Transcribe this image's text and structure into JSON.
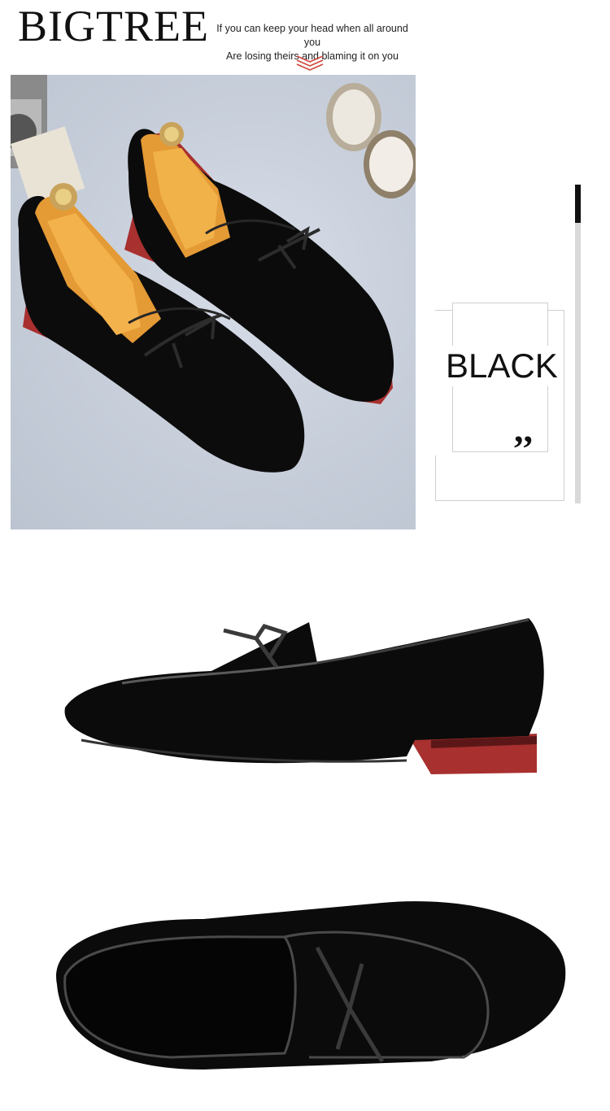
{
  "header": {
    "brand": "BIGTREE",
    "tagline_line1": "If you can keep your head when all around you",
    "tagline_line2": "Are losing theirs and blaming it on you"
  },
  "color_tag": {
    "label": "BLACK",
    "quote_mark": ",,"
  },
  "colors": {
    "shoe": "#0a0a0a",
    "heel_red": "#a8302f",
    "shoe_tree_wood": "#e8a13a",
    "accent_chevron": "#d0453a"
  }
}
